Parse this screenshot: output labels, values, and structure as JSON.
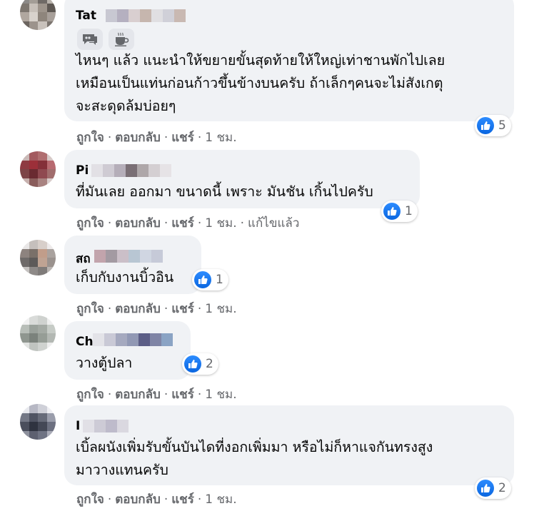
{
  "actions": {
    "like": "ถูกใจ",
    "reply": "ตอบกลับ",
    "share": "แชร์",
    "dot": "·"
  },
  "comments": [
    {
      "name": "Tat",
      "lines": [
        "ไหนๆ แล้ว แนะนำให้ขยายขั้นสุดท้ายให้ใหญ่เท่าชานพักไปเลย",
        "เหมือนเป็นแท่นก่อนก้าวขึ้นข้างบนครับ ถ้าเล็กๆคนจะไม่สังเกตุ",
        "จะสะดุดล้มบ่อยๆ"
      ],
      "time": "1 ชม.",
      "edited": "",
      "reactions": "5",
      "badges": [
        "top-fan-badge",
        "coffee-icon"
      ]
    },
    {
      "name": "Pi",
      "lines": [
        "ที่มันเลย ออกมา ขนาดนี้ เพราะ มันชัน เกิ้นไปครับ"
      ],
      "time": "1 ชม.",
      "edited": "แก้ไขแล้ว",
      "reactions": "1"
    },
    {
      "name": "สถ",
      "lines": [
        "เก็บกับงานบิ้วอิน"
      ],
      "time": "1 ชม.",
      "edited": "",
      "reactions": "1"
    },
    {
      "name": "Ch",
      "lines": [
        "วางตู้ปลา"
      ],
      "time": "1 ชม.",
      "edited": "",
      "reactions": "2"
    },
    {
      "name": "I",
      "lines": [
        "เบิ้ลผนังเพิ่มรับขั้นบันไดที่งอกเพิ่มมา หรือไม่ก็หาแจกันทรงสูง",
        "มาวางแทนครับ"
      ],
      "time": "1 ชม.",
      "edited": "",
      "reactions": "2"
    }
  ],
  "colors": {
    "bubble": "#f0f2f5",
    "like_blue": "#1877f2",
    "meta": "#65676b"
  }
}
